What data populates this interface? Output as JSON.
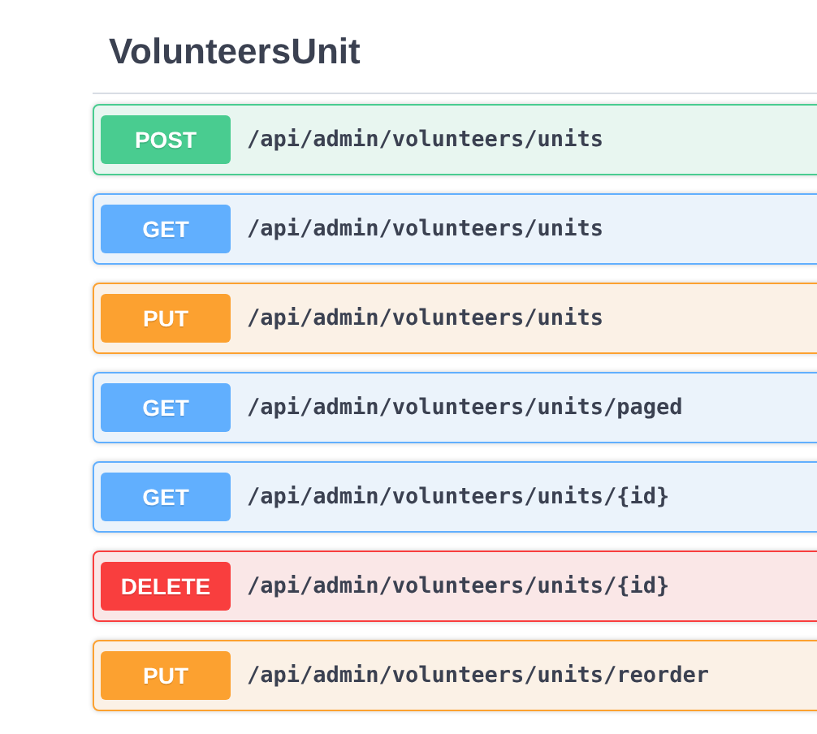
{
  "section": {
    "title": "VolunteersUnit"
  },
  "operations": [
    {
      "kind": "post",
      "method": "POST",
      "path": "/api/admin/volunteers/units"
    },
    {
      "kind": "get",
      "method": "GET",
      "path": "/api/admin/volunteers/units"
    },
    {
      "kind": "put",
      "method": "PUT",
      "path": "/api/admin/volunteers/units"
    },
    {
      "kind": "get",
      "method": "GET",
      "path": "/api/admin/volunteers/units/paged"
    },
    {
      "kind": "get",
      "method": "GET",
      "path": "/api/admin/volunteers/units/{id}"
    },
    {
      "kind": "delete",
      "method": "DELETE",
      "path": "/api/admin/volunteers/units/{id}"
    },
    {
      "kind": "put",
      "method": "PUT",
      "path": "/api/admin/volunteers/units/reorder"
    }
  ]
}
